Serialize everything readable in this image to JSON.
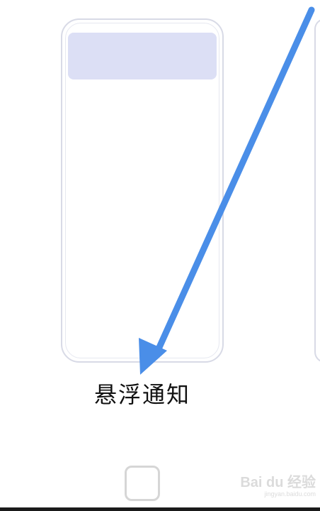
{
  "option": {
    "label": "悬浮通知"
  },
  "watermark": {
    "brand": "Bai du 经验",
    "url": "jingyan.baidu.com"
  },
  "colors": {
    "arrow": "#4a8ee8",
    "banner": "#dcdff5",
    "frame": "#d8dae6"
  },
  "icons": {
    "annotation": "arrow-pointer-icon",
    "home": "home-button-icon"
  }
}
